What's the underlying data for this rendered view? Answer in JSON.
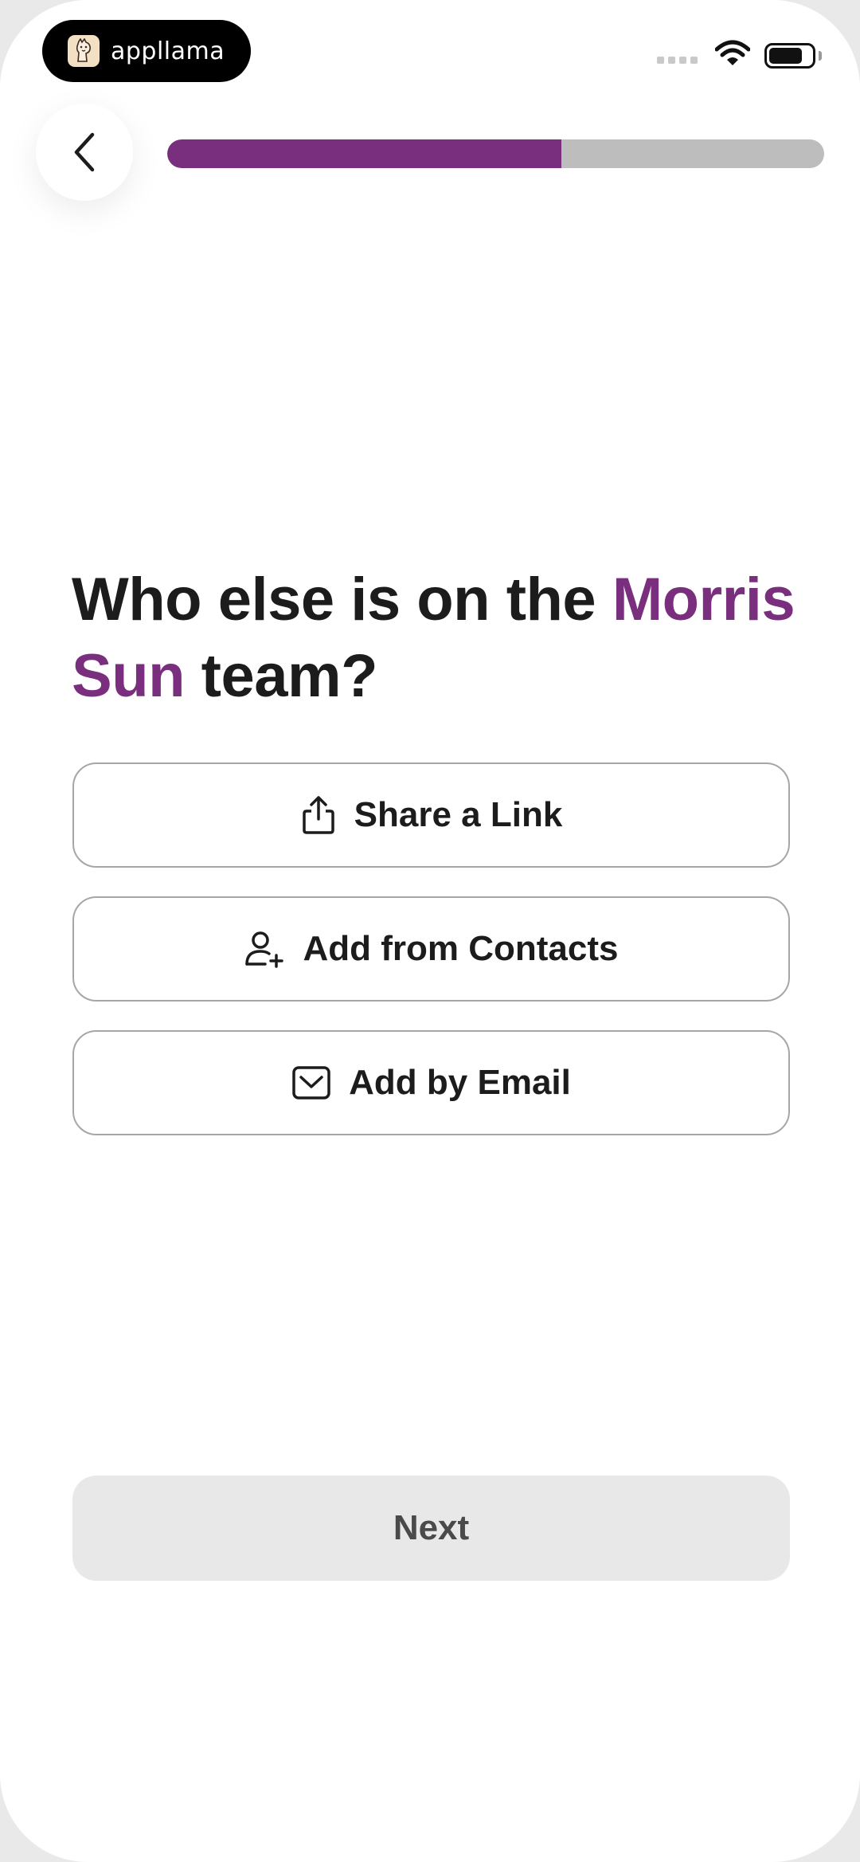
{
  "status_bar": {
    "brand_name": "appllama",
    "brand_icon": "llama-icon",
    "wifi_icon": "wifi-icon",
    "battery_icon": "battery-icon"
  },
  "header": {
    "back_icon": "chevron-left-icon",
    "progress_fraction": 0.6,
    "progress_color": "#7a2e7e"
  },
  "title": {
    "before_accent": "Who else is on the ",
    "accent": "Morris Sun",
    "after_accent": " team?",
    "accent_color": "#7a2e7e"
  },
  "options": [
    {
      "label": "Share a Link",
      "icon": "share-icon"
    },
    {
      "label": "Add from Contacts",
      "icon": "add-user-icon"
    },
    {
      "label": "Add by Email",
      "icon": "mail-icon"
    }
  ],
  "next_button": {
    "label": "Next"
  }
}
